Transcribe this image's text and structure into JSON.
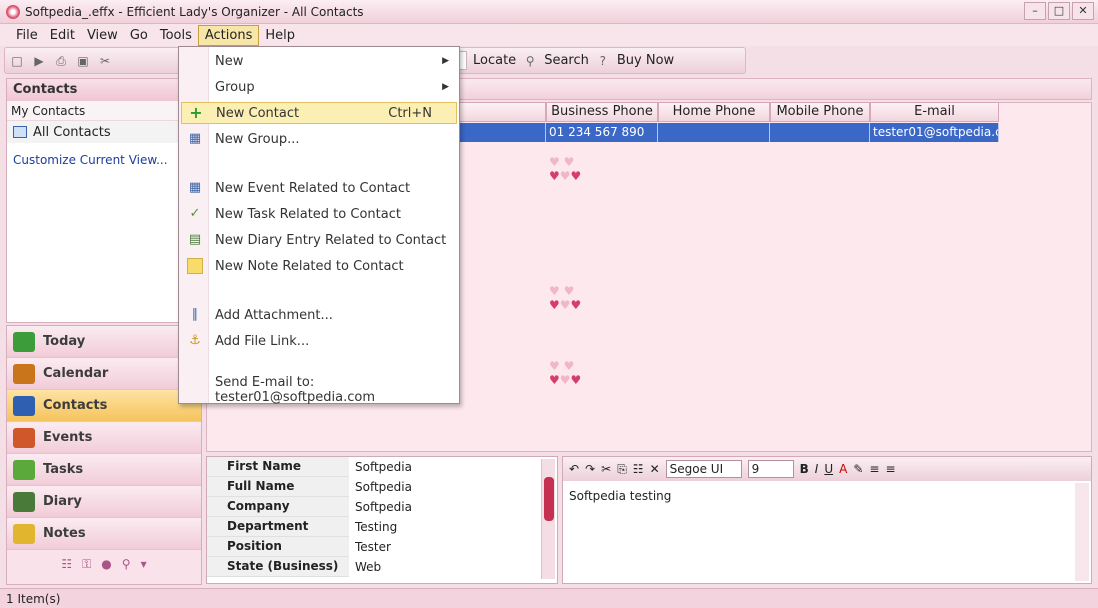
{
  "window": {
    "title": "Softpedia_.effx - Efficient Lady's Organizer - All Contacts",
    "buttons": [
      "–",
      "□",
      "✕"
    ]
  },
  "menubar": {
    "items": [
      "File",
      "Edit",
      "View",
      "Go",
      "Tools",
      "Actions",
      "Help"
    ],
    "active": "Actions"
  },
  "toolbar": {
    "locate_label": "Locate",
    "search_label": "Search",
    "buy_label": "Buy Now"
  },
  "left_pane": {
    "title": "Contacts",
    "group": "My Contacts",
    "folder": "All Contacts",
    "customize": "Customize Current View..."
  },
  "nav": {
    "items": [
      {
        "label": "Today",
        "color": "#3d9c3a"
      },
      {
        "label": "Calendar",
        "color": "#c8751b"
      },
      {
        "label": "Contacts",
        "color": "#2e5fb0"
      },
      {
        "label": "Events",
        "color": "#d0572a"
      },
      {
        "label": "Tasks",
        "color": "#5aa93a"
      },
      {
        "label": "Diary",
        "color": "#4a7a3a"
      },
      {
        "label": "Notes",
        "color": "#e2b52e"
      }
    ],
    "selected": "Contacts"
  },
  "grid": {
    "columns": [
      "pany",
      "Business Phone",
      "Home Phone",
      "Mobile Phone",
      "E-mail"
    ],
    "row": {
      "business_phone": "01 234 567 890",
      "email": "tester01@softpedia.com"
    }
  },
  "detail": {
    "fields": [
      {
        "label": "First Name",
        "value": "Softpedia"
      },
      {
        "label": "Full Name",
        "value": "Softpedia"
      },
      {
        "label": "Company",
        "value": "Softpedia"
      },
      {
        "label": "Department",
        "value": "Testing"
      },
      {
        "label": "Position",
        "value": "Tester"
      },
      {
        "label": "State (Business)",
        "value": "Web"
      }
    ]
  },
  "notes": {
    "font": "Segoe UI",
    "size": "9",
    "text": "Softpedia testing"
  },
  "statusbar": {
    "text": "1 Item(s)"
  },
  "dropdown": {
    "items": [
      {
        "label": "New",
        "submenu": true,
        "icon": ""
      },
      {
        "label": "Group",
        "submenu": true,
        "icon": ""
      },
      {
        "label": "New Contact",
        "shortcut": "Ctrl+N",
        "icon": "+",
        "highlighted": true
      },
      {
        "label": "New Group...",
        "icon": "▦"
      },
      {
        "label": "New Event Related to Contact",
        "icon": "▦"
      },
      {
        "label": "New Task Related to Contact",
        "icon": "✓"
      },
      {
        "label": "New Diary Entry Related to Contact",
        "icon": "▤"
      },
      {
        "label": "New Note Related to Contact",
        "icon": "□"
      },
      {
        "label": "Add Attachment...",
        "icon": "∥"
      },
      {
        "label": "Add File Link...",
        "icon": "⚓"
      },
      {
        "label": "Send E-mail to: tester01@softpedia.com",
        "icon": ""
      }
    ]
  }
}
